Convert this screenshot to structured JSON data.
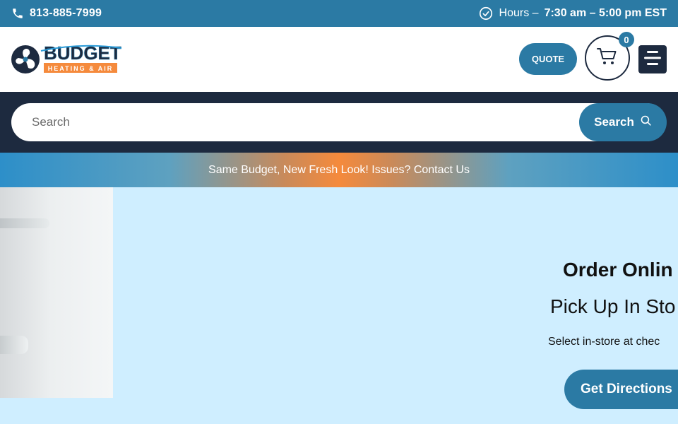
{
  "topbar": {
    "phone": "813-885-7999",
    "hours_label": "Hours –",
    "hours_value": "7:30 am – 5:00 pm EST",
    "icons": {
      "phone": "phone-icon",
      "clock": "clock-icon"
    }
  },
  "header": {
    "logo": {
      "brand": "BUDGET",
      "tagline": "HEATING & AIR"
    },
    "quote_label": "QUOTE",
    "cart_count": "0",
    "icons": {
      "cart": "cart-icon",
      "menu": "hamburger-menu-icon"
    }
  },
  "search": {
    "placeholder": "Search",
    "button_label": "Search",
    "icon": "search-icon"
  },
  "announcement": {
    "text": "Same Budget, New Fresh Look! Issues? Contact Us"
  },
  "hero": {
    "heading": "Order Onlin",
    "subheading": "Pick Up In Sto",
    "text": "Select in-store at chec",
    "button_label": "Get Directions"
  },
  "colors": {
    "primary_blue": "#2b7aa4",
    "navy": "#1d2a3f",
    "accent_orange": "#f58a3c",
    "hero_bg": "#cfeeff"
  }
}
